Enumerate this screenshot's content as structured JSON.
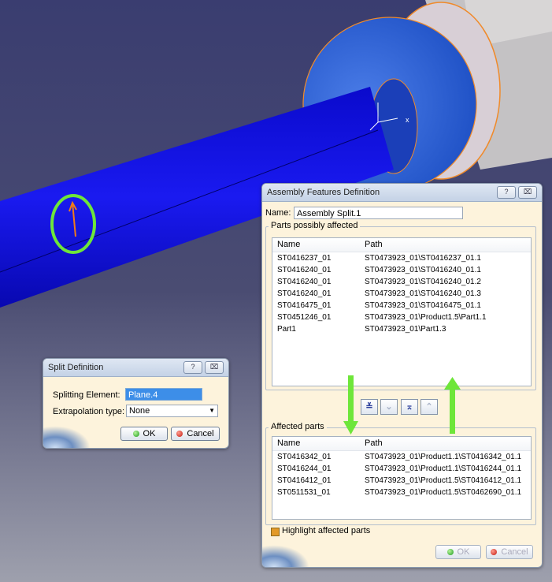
{
  "split_dialog": {
    "title": "Split Definition",
    "help_icon": "?",
    "close_icon": "⌧",
    "splitting_label": "Splitting Element:",
    "splitting_value": "Plane.4",
    "extrap_label": "Extrapolation type:",
    "extrap_value": "None",
    "ok_label": "OK",
    "cancel_label": "Cancel"
  },
  "assembly_dialog": {
    "title": "Assembly Features Definition",
    "help_icon": "?",
    "close_icon": "⌧",
    "name_label": "Name:",
    "name_value": "Assembly Split.1",
    "possibly_title": "Parts possibly affected",
    "col_name": "Name",
    "col_path": "Path",
    "possibly_rows": [
      {
        "name": "ST0416237_01",
        "path": "ST0473923_01\\ST0416237_01.1"
      },
      {
        "name": "ST0416240_01",
        "path": "ST0473923_01\\ST0416240_01.1"
      },
      {
        "name": "ST0416240_01",
        "path": "ST0473923_01\\ST0416240_01.2"
      },
      {
        "name": "ST0416240_01",
        "path": "ST0473923_01\\ST0416240_01.3"
      },
      {
        "name": "ST0416475_01",
        "path": "ST0473923_01\\ST0416475_01.1"
      },
      {
        "name": "ST0451246_01",
        "path": "ST0473923_01\\Product1.5\\Part1.1"
      },
      {
        "name": "Part1",
        "path": "ST0473923_01\\Part1.3"
      }
    ],
    "affected_title": "Affected parts",
    "affected_rows": [
      {
        "name": "ST0416342_01",
        "path": "ST0473923_01\\Product1.1\\ST0416342_01.1"
      },
      {
        "name": "ST0416244_01",
        "path": "ST0473923_01\\Product1.1\\ST0416244_01.1"
      },
      {
        "name": "ST0416412_01",
        "path": "ST0473923_01\\Product1.5\\ST0416412_01.1"
      },
      {
        "name": "ST0511531_01",
        "path": "ST0473923_01\\Product1.5\\ST0462690_01.1"
      }
    ],
    "highlight_label": "Highlight affected parts",
    "ok_label": "OK",
    "cancel_label": "Cancel"
  },
  "viewport": {
    "axis_x": "x",
    "model_color": "#1212d8",
    "background_color": "#3b3e6e",
    "annotation_color": "#6ee63a"
  }
}
